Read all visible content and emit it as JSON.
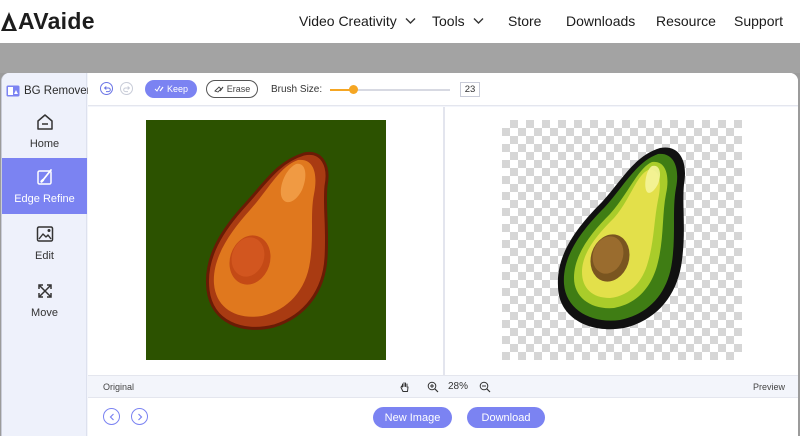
{
  "site": {
    "logo_text": "AVaide",
    "nav": [
      {
        "label": "Video Creativity",
        "has_dropdown": true
      },
      {
        "label": "Tools",
        "has_dropdown": true
      },
      {
        "label": "Store",
        "has_dropdown": false
      },
      {
        "label": "Downloads",
        "has_dropdown": false
      },
      {
        "label": "Resource",
        "has_dropdown": false
      },
      {
        "label": "Support",
        "has_dropdown": false
      }
    ]
  },
  "app": {
    "title": "BG Remover",
    "sidebar": [
      {
        "label": "Home",
        "icon": "home-icon",
        "active": false
      },
      {
        "label": "Edge Refine",
        "icon": "edge-refine-icon",
        "active": true
      },
      {
        "label": "Edit",
        "icon": "edit-image-icon",
        "active": false
      },
      {
        "label": "Move",
        "icon": "move-icon",
        "active": false
      }
    ],
    "toolbar": {
      "keep_label": "Keep",
      "erase_label": "Erase",
      "brush_size_label": "Brush Size:",
      "brush_size_value": "23",
      "brush_fraction": 0.19
    },
    "status": {
      "original_label": "Original",
      "preview_label": "Preview",
      "zoom": "28%"
    },
    "actions": {
      "new_image_label": "New Image",
      "download_label": "Download"
    }
  },
  "colors": {
    "accent": "#7b83f2",
    "slider": "#f5a623",
    "original_bg": "#2c5200"
  }
}
